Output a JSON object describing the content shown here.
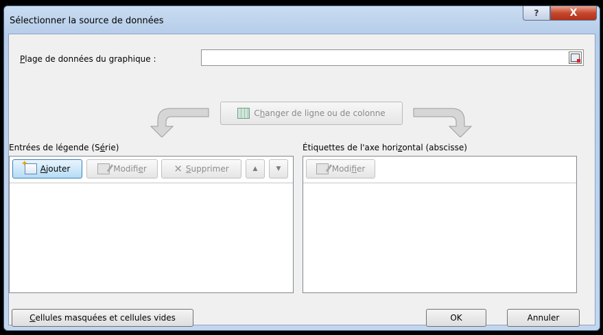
{
  "window": {
    "title": "Sélectionner la source de données",
    "help_label": "?",
    "close_label": "X"
  },
  "range": {
    "label_first": "P",
    "label_rest": "lage de données du graphique :",
    "value": ""
  },
  "switch_button": {
    "label_a": "C",
    "label_ul": "h",
    "label_b": "anger de ligne ou de colonne"
  },
  "legend": {
    "title_a": "Entrées de légende (S",
    "title_ul": "é",
    "title_b": "rie)",
    "add_ul": "A",
    "add_rest": "jouter",
    "edit_a": "Modifi",
    "edit_ul": "e",
    "edit_b": "r",
    "delete_ul": "S",
    "delete_rest": "upprimer",
    "up_icon": "▲",
    "down_icon": "▼",
    "items": []
  },
  "axis": {
    "title_a": "Étiquettes de l'axe hori",
    "title_ul": "z",
    "title_b": "ontal (abscisse)",
    "edit_a": "Modi",
    "edit_ul": "f",
    "edit_b": "ier",
    "items": []
  },
  "footer": {
    "hidden_cells_ul": "C",
    "hidden_cells_rest": "ellules masquées et cellules vides",
    "ok_label": "OK",
    "cancel_label": "Annuler"
  }
}
